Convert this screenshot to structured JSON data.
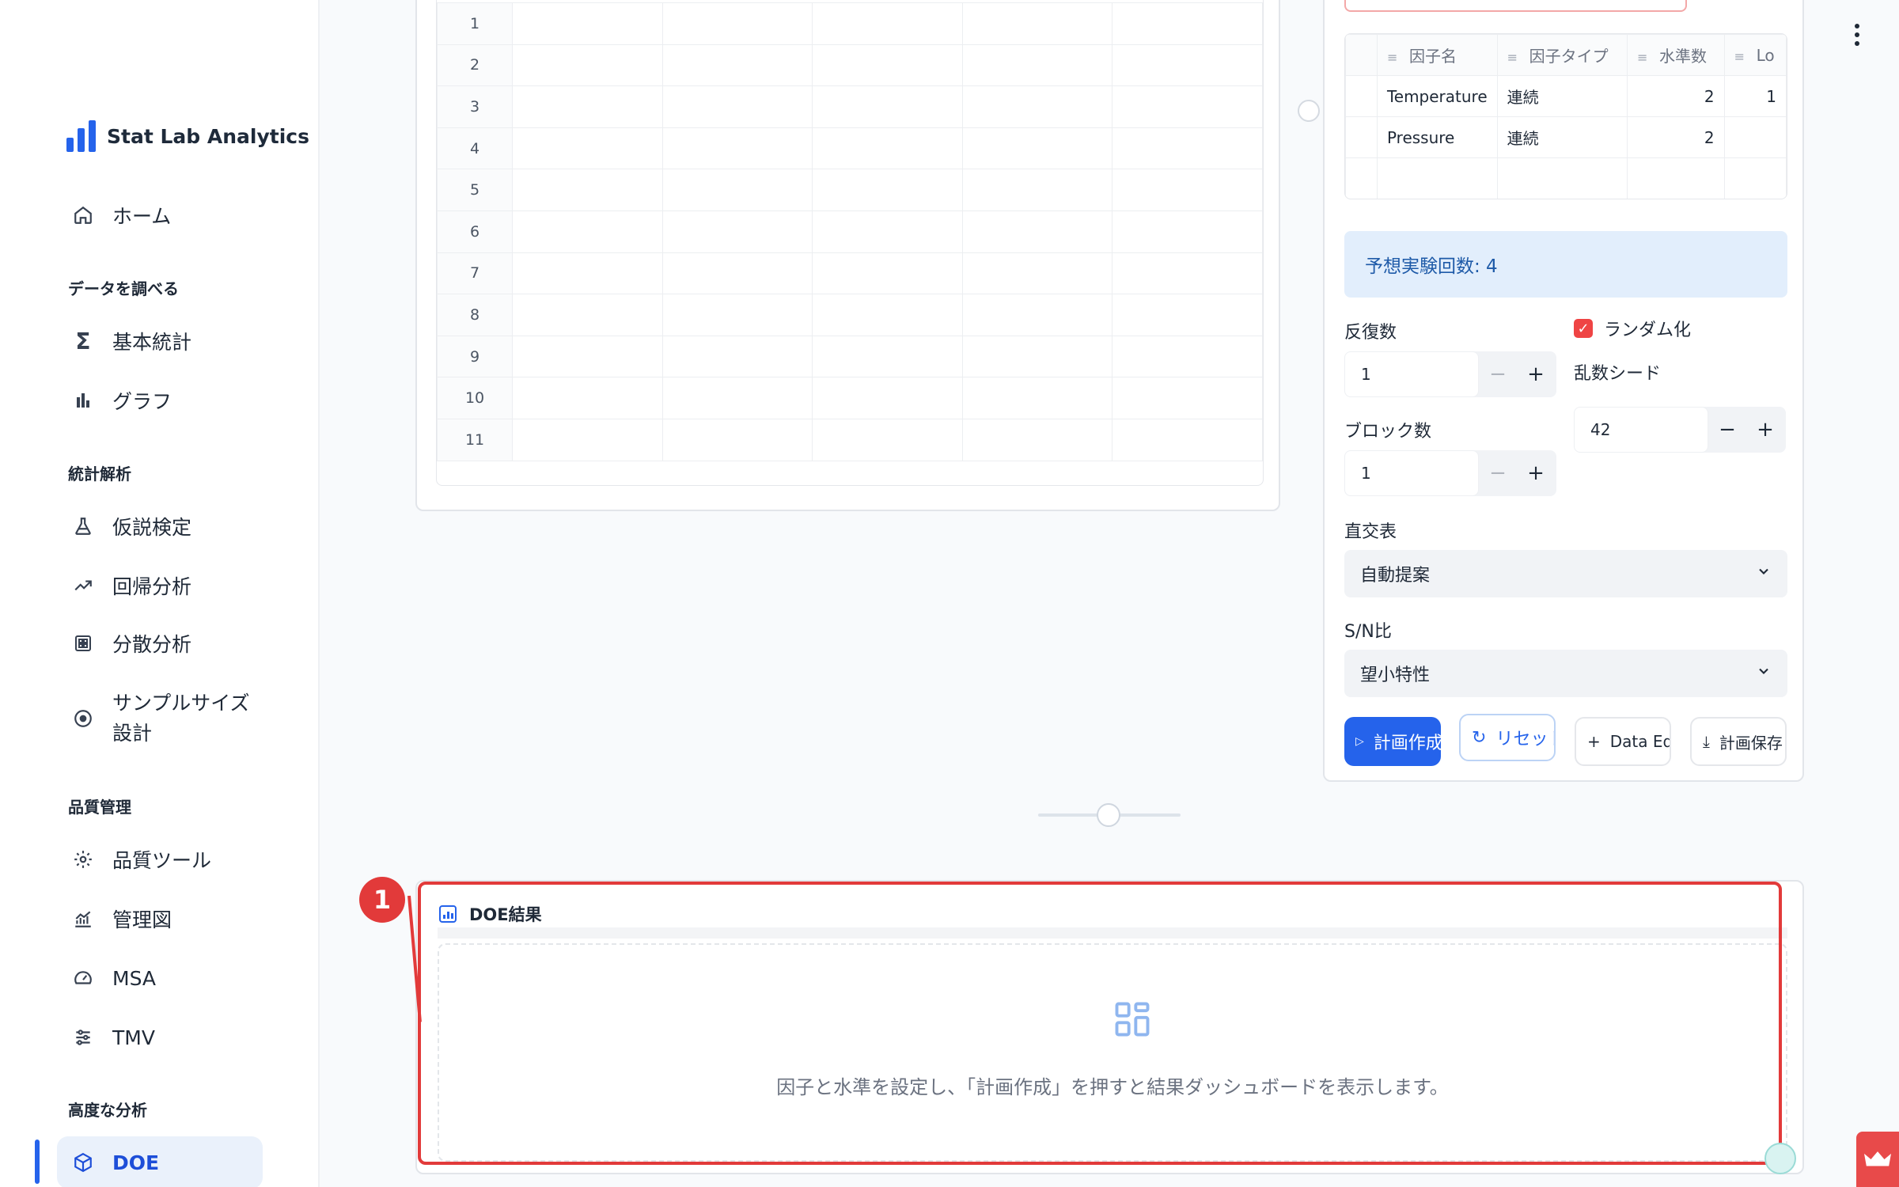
{
  "app": {
    "name": "Stat Lab Analytics"
  },
  "sidebar": {
    "home": "ホーム",
    "sections": {
      "explore": "データを調べる",
      "stats": "統計解析",
      "quality": "品質管理",
      "advanced": "高度な分析"
    },
    "items": {
      "basic_stats": "基本統計",
      "graph": "グラフ",
      "hypothesis": "仮説検定",
      "regression": "回帰分析",
      "anova": "分散分析",
      "sample_size_1": "サンプルサイズ",
      "sample_size_2": "設計",
      "quality_tools": "品質ツール",
      "control_chart": "管理図",
      "msa": "MSA",
      "tmv": "TMV",
      "doe": "DOE"
    },
    "colors": {
      "accent": "#2563eb"
    }
  },
  "data_grid": {
    "row_numbers": [
      "1",
      "2",
      "3",
      "4",
      "5",
      "6",
      "7",
      "8",
      "9",
      "10",
      "11"
    ]
  },
  "factors": {
    "headers": [
      "因子名",
      "因子タイプ",
      "水準数",
      "Lo"
    ],
    "rows": [
      {
        "name": "Temperature",
        "type": "連続",
        "levels": "2",
        "low": "1"
      },
      {
        "name": "Pressure",
        "type": "連続",
        "levels": "2",
        "low": ""
      }
    ]
  },
  "design": {
    "expected_runs_label": "予想実験回数: 4",
    "replicates_label": "反復数",
    "replicates_value": "1",
    "blocks_label": "ブロック数",
    "blocks_value": "1",
    "randomize_label": "ランダム化",
    "seed_label": "乱数シード",
    "seed_value": "42",
    "orthogonal_label": "直交表",
    "orthogonal_value": "自動提案",
    "sn_label": "S/N比",
    "sn_value": "望小特性",
    "minus": "−",
    "plus": "+"
  },
  "actions": {
    "create": "計画作成",
    "reset": "リセット",
    "data_editor": "Data Editor",
    "save": "計画保存"
  },
  "result": {
    "title": "DOE結果",
    "empty_message": "因子と水準を設定し、「計画作成」を押すと結果ダッシュボードを表示します。"
  },
  "annotation": {
    "badge": "1",
    "color": "#e23a3a"
  }
}
